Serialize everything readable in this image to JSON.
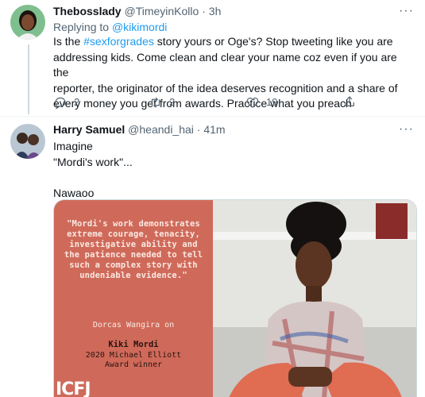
{
  "tweet1": {
    "display_name": "Thebosslady",
    "handle": "@TimeyinKollo",
    "separator": "·",
    "time": "3h",
    "more": "···",
    "replying_prefix": "Replying to",
    "replying_to": "@kikimordi",
    "text_before_hashtag": "Is the",
    "hashtag": "#sexforgrades",
    "text_line1_rest": "story yours or Oge's? Stop tweeting like you are",
    "text_line2": "addressing kids. Come clean and clear your name coz even if you are the",
    "text_line3": "reporter,  the originator of the idea deserves recognition and a share of",
    "text_line4": "every money you get from awards. Practice what you preach",
    "replies": "2",
    "retweets": "2",
    "likes": "19"
  },
  "tweet2": {
    "display_name": "Harry Samuel",
    "handle": "@heandi_hai",
    "separator": "·",
    "time": "41m",
    "more": "···",
    "line1": "Imagine",
    "line2": "\"Mordi's work\"...",
    "line3": "Nawaoo"
  },
  "media": {
    "quote": "\"Mordi's work demonstrates extreme courage, tenacity, investigative ability and the patience needed to tell such a complex story with undeniable evidence.\"",
    "attribution": "Dorcas Wangira on",
    "award_name": "Kiki Mordi",
    "award_line1": "2020 Michael Elliott",
    "award_line2": "Award winner",
    "logo": "ICFJ"
  },
  "colors": {
    "link": "#1d9bf0",
    "muted": "#536471",
    "media_panel": "#cf6a5a"
  }
}
